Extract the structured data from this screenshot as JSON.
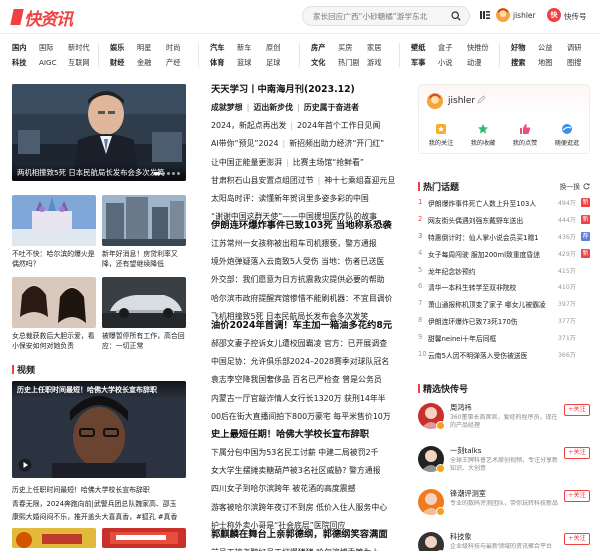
{
  "header": {
    "logo": "快资讯",
    "search_placeholder": "家长回应广西“小砂糖橘”游学东北",
    "user_name": "jishler",
    "kuai_badge": "快",
    "kuai_label": "快传号"
  },
  "nav": [
    {
      "row1": [
        "国内",
        "国际",
        "新时代"
      ],
      "row2": [
        "科技",
        "AIGC",
        "互联网"
      ]
    },
    {
      "row1": [
        "娱乐",
        "明星",
        "时尚"
      ],
      "row2": [
        "财经",
        "金融",
        "产经"
      ]
    },
    {
      "row1": [
        "汽车",
        "新车",
        "原创"
      ],
      "row2": [
        "体育",
        "篮球",
        "足球"
      ]
    },
    {
      "row1": [
        "房产",
        "买房",
        "家居"
      ],
      "row2": [
        "文化",
        "热门剧",
        "游戏"
      ]
    },
    {
      "row1": [
        "壁纸",
        "盒子",
        "快推份"
      ],
      "row2": [
        "军事",
        "小说",
        "动漫"
      ]
    },
    {
      "row1": [
        "好物",
        "公益",
        "调研"
      ],
      "row2": [
        "搜索",
        "地图",
        "图搜"
      ]
    }
  ],
  "left": {
    "hero_caption": "两机相撞致5死 日本民航局长发布会多次发笑",
    "grid": [
      {
        "title": "不吐不快：哈尔滨的爆火是偶然吗？"
      },
      {
        "title": "新年好消息！房贷利率又降，还有望继续降低"
      },
      {
        "title": "女总裁获救后大胆示爱，看小保安如何对她负责"
      },
      {
        "title": "被曝暂停所有工作，高合回应：一切正常"
      }
    ],
    "video_heading": "视频",
    "video_overlay": "历史上任职时间最短！哈佛大学校长宣布辞职",
    "video_caption": "历史上任职时间最短！哈佛大学校长宣布辞职",
    "video_lines": [
      "青春无限，2024奔跑向前|武警兵团总队魏家高、邵玉",
      "康熙大婚闷闷不乐，推开盖头大喜真香，#狐孔 #真香"
    ],
    "hero_dots": 5
  },
  "middle": {
    "blocks": [
      {
        "headline": "天天学习丨中南海月刊(2023.12)",
        "lines": [
          {
            "bold": true,
            "parts": [
              "成就梦想",
              "迈出新步伐",
              "历史属于奋进者"
            ]
          },
          {
            "bold": false,
            "parts": [
              "2024，新起点再出发",
              "2024年首个工作日见闻"
            ]
          },
          {
            "bold": false,
            "parts": [
              "AI带你“预见”2024",
              "新招频出助力经济“开门红”"
            ]
          },
          {
            "bold": false,
            "parts": [
              "让中国正能量更澎湃",
              "比赛主场馆“抢鲜看”"
            ]
          },
          {
            "bold": false,
            "parts": [
              "甘肃积石山县安置点组团过节",
              "神十七乘组喜迎元旦"
            ]
          },
          {
            "bold": false,
            "parts": [
              "太阳岛时评：读懂新年贺词里多姿多彩的中国"
            ]
          },
          {
            "bold": false,
            "parts": [
              "“谢谢中国这群天使”——中国援坦医疗队的故事"
            ]
          }
        ]
      },
      {
        "headline": "伊朗连环爆炸事件已致103死 当地称系恐袭",
        "lines": [
          {
            "bold": false,
            "parts": [
              "江苏常州一女孩称被出租车司机猥亵，警方通报"
            ]
          },
          {
            "bold": false,
            "parts": [
              "境外炮弹疑落入云南致5人受伤 当地：伤者已送医"
            ]
          },
          {
            "bold": false,
            "parts": [
              "外交部：我们愿意为日方抗震救灾提供必要的帮助"
            ]
          },
          {
            "bold": false,
            "parts": [
              "哈尔滨市政府提醒宾馆惨惜不能刷机器：不宜目调价"
            ]
          },
          {
            "bold": false,
            "parts": [
              "飞机相撞致5死 日本民航局长发布会多次发笑"
            ]
          }
        ]
      },
      {
        "headline": "油价2024年首调！车主加一箱油多花约8元",
        "lines": [
          {
            "bold": false,
            "parts": [
              "郝邵文妻子控诉女儿遭校园霸凌 官方：已开展调查"
            ]
          },
          {
            "bold": false,
            "parts": [
              "中国足协：允许俱乐部2024–2028赛季对球队冠名"
            ]
          },
          {
            "bold": false,
            "parts": [
              "袁志李空降我国奢侈品 百名已严检查 曾是公务员"
            ]
          },
          {
            "bold": false,
            "parts": [
              "内蒙古一厅官敲诈情人女行长1320万 获刑14年半"
            ]
          },
          {
            "bold": false,
            "parts": [
              "00后在街大直播间拍下800万豪宅 每平米售价10万"
            ]
          }
        ]
      },
      {
        "headline": "史上最短任期！哈佛大学校长宣布辞职",
        "lines": [
          {
            "bold": false,
            "parts": [
              "下属分包中国为53名民工讨薪 中建二局被罚2千"
            ]
          },
          {
            "bold": false,
            "parts": [
              "女大学生摆摊卖糖葫芦被3名社区威胁? 警方通报"
            ]
          },
          {
            "bold": false,
            "parts": [
              "四川女子到哈尔滨跨年 被花酒的高度震撼"
            ]
          },
          {
            "bold": false,
            "parts": [
              "游客被哈尔滨跨年夜订不到房 低价入住人服务中心"
            ]
          },
          {
            "bold": false,
            "parts": [
              "护士称外卖小哥是“社会底层”医院回应"
            ]
          }
        ]
      },
      {
        "headline": "郭麒麟在舞台上亲郭德纲，郭德纲笑容满面",
        "lines": [
          {
            "bold": false,
            "parts": [
              "前员工被老鸭好员工打爆猪猪 哈尔滨博乘管为上"
            ]
          }
        ]
      }
    ]
  },
  "right": {
    "user": {
      "name": "jishler",
      "actions": [
        "我的关注",
        "我的收藏",
        "我的点赞",
        "随便逛逛"
      ]
    },
    "hot": {
      "title": "热门话题",
      "change": "换一换",
      "items": [
        {
          "n": "1",
          "t": "伊朗爆炸事件死亡人数上升至103人",
          "c": "494万",
          "tag": "新",
          "color": "#f04142"
        },
        {
          "n": "2",
          "t": "网友街头偶遇刘强东戴野车送出",
          "c": "444万",
          "tag": "新",
          "color": "#f04142"
        },
        {
          "n": "3",
          "t": "特惠倒计时：仙人掌小说会员买1赠1",
          "c": "436万",
          "tag": "荐",
          "color": "#5b7fe0"
        },
        {
          "n": "4",
          "t": "女子每周闯驶 服加200ml致重度昏迷",
          "c": "429万",
          "tag": "新",
          "color": "#f04142"
        },
        {
          "n": "5",
          "t": "龙年纪念钞预约",
          "c": "415万",
          "tag": "",
          "color": ""
        },
        {
          "n": "6",
          "t": "清华一本科生转学至双非院校",
          "c": "410万",
          "tag": "",
          "color": ""
        },
        {
          "n": "7",
          "t": "萧山通报称机顶变了家子 哪女儿被霸凌",
          "c": "397万",
          "tag": "",
          "color": ""
        },
        {
          "n": "8",
          "t": "伊朗连环爆炸已致73死170伤",
          "c": "377万",
          "tag": "",
          "color": ""
        },
        {
          "n": "9",
          "t": "甜馨neinei十年后同框",
          "c": "371万",
          "tag": "",
          "color": ""
        },
        {
          "n": "10",
          "t": "云南5人因不明弹落入受伤被送医",
          "c": "366万",
          "tag": "",
          "color": ""
        }
      ]
    },
    "fast": {
      "title": "精选快传号",
      "items": [
        {
          "name": "周鸿祎",
          "desc": "360董事长首席官，爱经的程序员，现在的产品经理",
          "follow": "+关注",
          "bg": "#c9302c"
        },
        {
          "name": "一刻talks",
          "desc": "全球王牌科普艺术原创视频，专注分享新知识、大创意",
          "follow": "+关注",
          "bg": "#222"
        },
        {
          "name": "锋潮评测室",
          "desc": "专业的数码评测团队，带你玩转科技新品",
          "follow": "+关注",
          "bg": "#ef7b1e"
        },
        {
          "name": "科技象",
          "desc": "企业级科技与最新领域的资讯聚合平台",
          "follow": "+关注",
          "bg": "#333"
        }
      ]
    }
  }
}
